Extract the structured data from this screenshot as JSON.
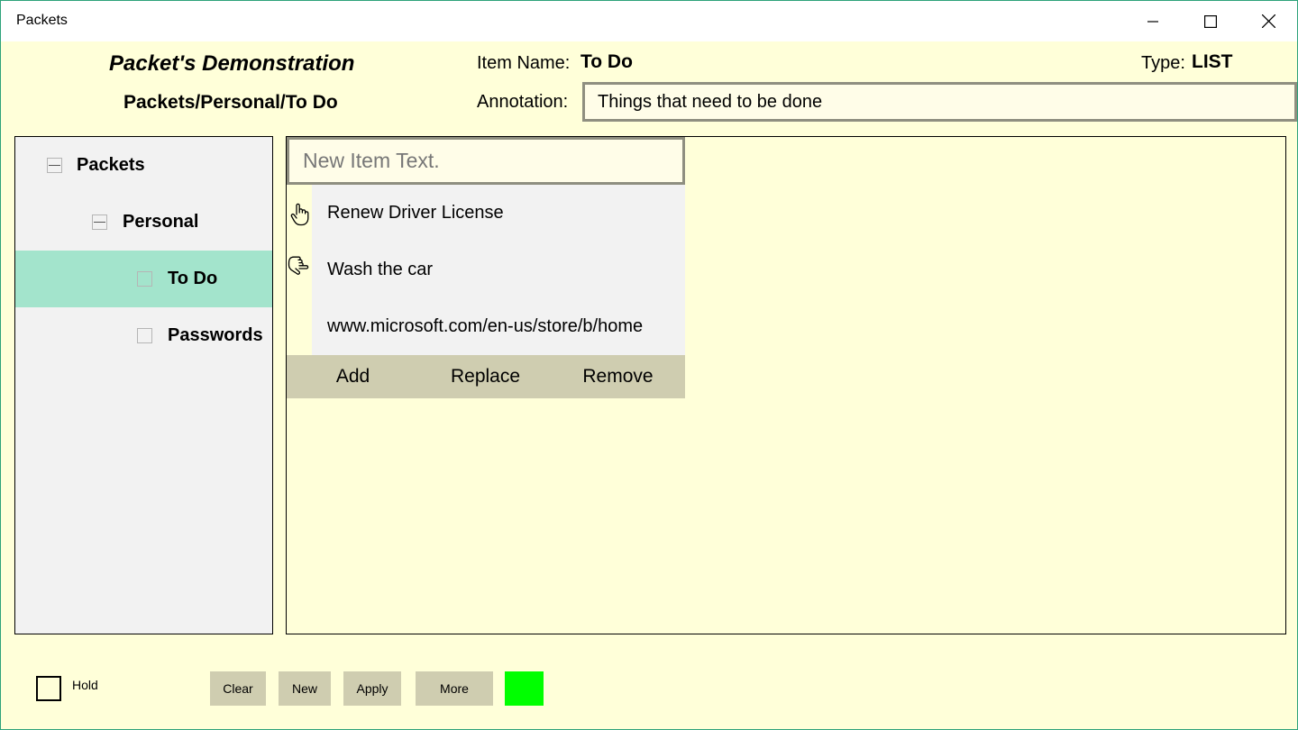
{
  "window": {
    "title": "Packets",
    "minimize_icon": "minimize-icon",
    "maximize_icon": "maximize-icon",
    "close_icon": "close-icon"
  },
  "header": {
    "demo_title": "Packet's Demonstration",
    "path": "Packets/Personal/To Do",
    "item_name_label": "Item Name:",
    "item_name_value": "To Do",
    "type_label": "Type:",
    "type_value": "LIST",
    "annotation_label": "Annotation:",
    "annotation_value": "Things that need to be done"
  },
  "tree": {
    "items": [
      {
        "label": "Packets",
        "state": "expanded"
      },
      {
        "label": "Personal",
        "state": "expanded"
      },
      {
        "label": "To Do",
        "state": "leaf",
        "selected": true
      },
      {
        "label": "Passwords",
        "state": "leaf"
      }
    ],
    "selected_color": "#a3e4cc"
  },
  "list": {
    "new_item_placeholder": "New Item Text.",
    "items": [
      {
        "text": "Renew Driver License",
        "icon": "hand-pointer-up-icon"
      },
      {
        "text": "Wash the car",
        "icon": "hand-pointer-down-icon"
      },
      {
        "text": "www.microsoft.com/en-us/store/b/home",
        "icon": ""
      }
    ],
    "actions": {
      "add": "Add",
      "replace": "Replace",
      "remove": "Remove"
    }
  },
  "footer": {
    "hold_label": "Hold",
    "clear_label": "Clear",
    "new_label": "New",
    "apply_label": "Apply",
    "more_label": "More",
    "status_color": "#00ff00"
  },
  "colors": {
    "background": "#ffffd9",
    "button": "#cfcdb0",
    "accent_border": "#2ea37a"
  }
}
